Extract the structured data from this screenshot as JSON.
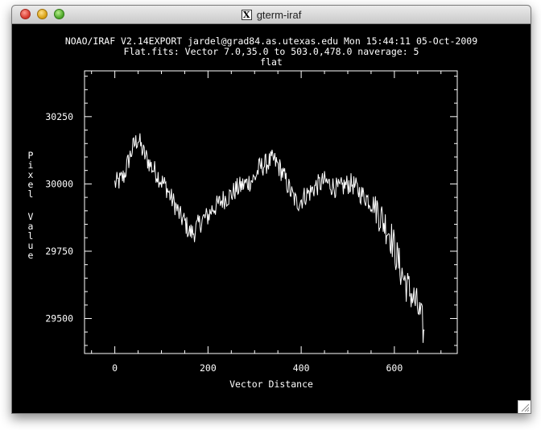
{
  "window": {
    "title": "gterm-iraf",
    "icon": "x11-icon"
  },
  "plot": {
    "header_line1": "NOAO/IRAF V2.14EXPORT jardel@grad84.as.utexas.edu Mon 15:44:11 05-Oct-2009",
    "header_line2": "Flat.fits: Vector 7.0,35.0 to 503.0,478.0 naverage: 5",
    "header_line3": "flat",
    "xlabel": "Vector Distance",
    "ylabel": "Pixel Value",
    "background": "#000000",
    "foreground": "#ffffff"
  },
  "chart_data": {
    "type": "line",
    "title": "flat",
    "xlabel": "Vector Distance",
    "ylabel": "Pixel Value",
    "xlim": [
      -65,
      735
    ],
    "ylim": [
      29370,
      30420
    ],
    "xticks": [
      0,
      200,
      400,
      600
    ],
    "yticks": [
      29500,
      29750,
      30000,
      30250
    ],
    "grid": false,
    "series": [
      {
        "values_x": [
          0,
          10,
          20,
          30,
          40,
          50,
          60,
          70,
          80,
          90,
          100,
          110,
          120,
          130,
          140,
          150,
          160,
          170,
          180,
          190,
          200,
          210,
          220,
          230,
          240,
          250,
          260,
          270,
          280,
          290,
          300,
          310,
          320,
          330,
          340,
          350,
          360,
          370,
          380,
          390,
          400,
          410,
          420,
          430,
          440,
          450,
          460,
          470,
          480,
          490,
          500,
          510,
          520,
          530,
          540,
          550,
          560,
          570,
          580,
          590,
          600,
          610,
          620,
          630,
          640,
          650,
          660,
          665
        ],
        "values_y": [
          30000,
          30010,
          30030,
          30090,
          30140,
          30170,
          30120,
          30090,
          30060,
          30040,
          30010,
          29990,
          29950,
          29920,
          29880,
          29860,
          29820,
          29820,
          29850,
          29870,
          29880,
          29910,
          29920,
          29940,
          29950,
          29960,
          29980,
          29990,
          30000,
          30010,
          30020,
          30060,
          30070,
          30080,
          30090,
          30070,
          30040,
          30000,
          29960,
          29930,
          29940,
          29960,
          29970,
          29990,
          30000,
          30010,
          30000,
          29990,
          29980,
          29990,
          30000,
          30000,
          29980,
          29960,
          29950,
          29930,
          29920,
          29880,
          29850,
          29820,
          29760,
          29700,
          29650,
          29610,
          29580,
          29540,
          29480,
          29420
        ]
      }
    ]
  }
}
